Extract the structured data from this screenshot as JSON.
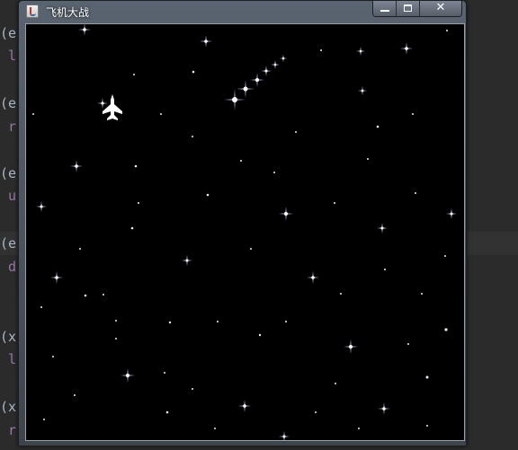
{
  "window": {
    "title": "飞机大战"
  },
  "background_code": [
    {
      "text": "(e"
    },
    {
      "text": " l",
      "kw": true
    },
    {
      "text": "(e"
    },
    {
      "text": " r",
      "kw": true
    },
    {
      "text": "(e"
    },
    {
      "text": " u",
      "kw": true
    },
    {
      "text": "(e"
    },
    {
      "text": " d",
      "kw": true
    },
    {
      "text": "(x"
    },
    {
      "text": " l",
      "kw": true
    },
    {
      "text": "(x"
    },
    {
      "text": " r",
      "kw": true
    }
  ],
  "game": {
    "background_color": "#000000",
    "star_color": "#c8d4ff",
    "player": {
      "name": "player-plane",
      "color": "#ffffff"
    }
  }
}
